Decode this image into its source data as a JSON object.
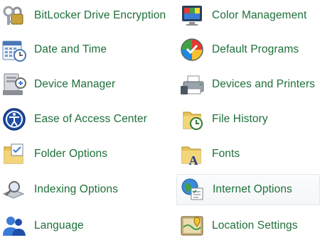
{
  "items": [
    {
      "label": "BitLocker Drive Encryption",
      "icon": "key-lock-icon"
    },
    {
      "label": "Color Management",
      "icon": "color-monitor-icon"
    },
    {
      "label": "Date and Time",
      "icon": "calendar-clock-icon"
    },
    {
      "label": "Default Programs",
      "icon": "default-programs-icon"
    },
    {
      "label": "Device Manager",
      "icon": "device-manager-icon"
    },
    {
      "label": "Devices and Printers",
      "icon": "printer-icon"
    },
    {
      "label": "Ease of Access Center",
      "icon": "ease-of-access-icon"
    },
    {
      "label": "File History",
      "icon": "file-history-icon"
    },
    {
      "label": "Folder Options",
      "icon": "folder-options-icon"
    },
    {
      "label": "Fonts",
      "icon": "fonts-folder-icon"
    },
    {
      "label": "Indexing Options",
      "icon": "indexing-options-icon"
    },
    {
      "label": "Internet Options",
      "icon": "internet-options-icon"
    },
    {
      "label": "Language",
      "icon": "language-icon"
    },
    {
      "label": "Location Settings",
      "icon": "location-settings-icon"
    }
  ],
  "colors": {
    "link": "#1e6f39",
    "hover_border": "#e3e7ec"
  }
}
